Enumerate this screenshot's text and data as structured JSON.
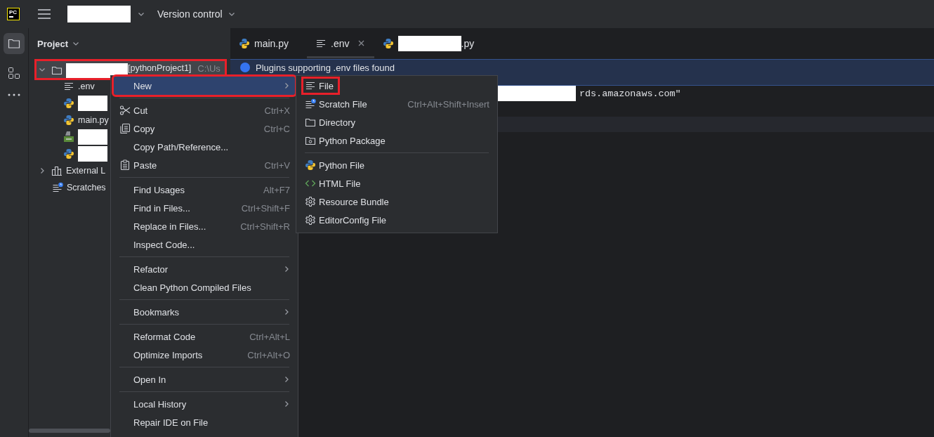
{
  "top_bar": {
    "logo_text": "PC",
    "menu_label": "Version control"
  },
  "tool_window": {
    "title": "Project"
  },
  "tree": [
    {
      "label": "[pythonProject1]",
      "path": "C:\\Us",
      "kind": "folder",
      "redacted": true,
      "expanded": true,
      "selected": true,
      "children": [
        {
          "label": ".env",
          "kind": "text",
          "redacted": false
        },
        {
          "kind": "python",
          "redacted": true
        },
        {
          "label": "main.py",
          "kind": "python",
          "redacted": false
        },
        {
          "kind": "qt",
          "redacted": true
        },
        {
          "kind": "python",
          "redacted": true
        }
      ]
    },
    {
      "label": "External L",
      "kind": "library",
      "redacted": false,
      "expanded": false,
      "selected": false
    },
    {
      "label": "Scratches",
      "kind": "scratches",
      "redacted": false,
      "selected": false
    }
  ],
  "tabs": [
    {
      "label": "main.py",
      "kind": "python",
      "redacted": false,
      "selected": false
    },
    {
      "label": ".env",
      "kind": "text",
      "redacted": false,
      "selected": true
    },
    {
      "label": ".py",
      "kind": "python",
      "redacted": true,
      "selected": false
    }
  ],
  "banner": {
    "text": "Plugins supporting .env files found"
  },
  "editor": {
    "lines": [
      {
        "text": "rds.amazonaws.com\"",
        "redacted": true,
        "current": false
      },
      {
        "current": false
      },
      {
        "current": true
      }
    ]
  },
  "context_menu": [
    {
      "kind": "item",
      "label": "New",
      "submenu": true,
      "selected": true
    },
    {
      "kind": "separator"
    },
    {
      "kind": "item",
      "label": "Cut",
      "shortcut": "Ctrl+X",
      "selected": false
    },
    {
      "kind": "item",
      "label": "Copy",
      "shortcut": "Ctrl+C",
      "selected": false
    },
    {
      "kind": "item",
      "label": "Copy Path/Reference...",
      "selected": false
    },
    {
      "kind": "item",
      "label": "Paste",
      "shortcut": "Ctrl+V",
      "selected": false
    },
    {
      "kind": "separator"
    },
    {
      "kind": "item",
      "label": "Find Usages",
      "shortcut": "Alt+F7",
      "selected": false
    },
    {
      "kind": "item",
      "label": "Find in Files...",
      "shortcut": "Ctrl+Shift+F",
      "selected": false
    },
    {
      "kind": "item",
      "label": "Replace in Files...",
      "shortcut": "Ctrl+Shift+R",
      "selected": false
    },
    {
      "kind": "item",
      "label": "Inspect Code...",
      "selected": false
    },
    {
      "kind": "separator"
    },
    {
      "kind": "item",
      "label": "Refactor",
      "submenu": true,
      "selected": false
    },
    {
      "kind": "item",
      "label": "Clean Python Compiled Files",
      "selected": false
    },
    {
      "kind": "separator"
    },
    {
      "kind": "item",
      "label": "Bookmarks",
      "submenu": true,
      "selected": false
    },
    {
      "kind": "separator"
    },
    {
      "kind": "item",
      "label": "Reformat Code",
      "shortcut": "Ctrl+Alt+L",
      "selected": false
    },
    {
      "kind": "item",
      "label": "Optimize Imports",
      "shortcut": "Ctrl+Alt+O",
      "selected": false
    },
    {
      "kind": "separator"
    },
    {
      "kind": "item",
      "label": "Open In",
      "submenu": true,
      "selected": false
    },
    {
      "kind": "separator"
    },
    {
      "kind": "item",
      "label": "Local History",
      "submenu": true,
      "selected": false
    },
    {
      "kind": "item",
      "label": "Repair IDE on File",
      "selected": false
    }
  ],
  "new_submenu": [
    {
      "kind": "item",
      "label": "File",
      "selected": false
    },
    {
      "kind": "item",
      "label": "Scratch File",
      "shortcut": "Ctrl+Alt+Shift+Insert",
      "selected": false
    },
    {
      "kind": "item",
      "label": "Directory",
      "selected": false
    },
    {
      "kind": "item",
      "label": "Python Package",
      "selected": false
    },
    {
      "kind": "separator"
    },
    {
      "kind": "item",
      "label": "Python File",
      "selected": false
    },
    {
      "kind": "item",
      "label": "HTML File",
      "selected": false
    },
    {
      "kind": "item",
      "label": "Resource Bundle",
      "selected": false
    },
    {
      "kind": "item",
      "label": "EditorConfig File",
      "selected": false
    }
  ]
}
